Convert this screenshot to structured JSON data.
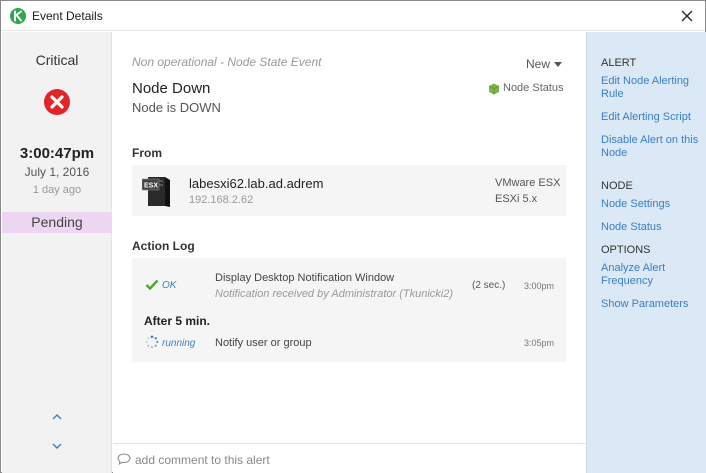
{
  "window": {
    "title": "Event Details",
    "close_icon": "close-icon"
  },
  "left": {
    "severity": "Critical",
    "severity_icon": "critical-x-icon",
    "severity_color": "#e02626",
    "time": "3:00:47pm",
    "date": "July 1, 2016",
    "ago": "1 day ago",
    "state": "Pending",
    "state_color": "#ecd6f2"
  },
  "event": {
    "type": "Non operational - Node State Event",
    "status": "New",
    "title": "Node Down",
    "subtitle": "Node is DOWN",
    "monitor_label": "Node Status",
    "monitor_icon_color": "#7ab648"
  },
  "from": {
    "heading": "From",
    "node_name": "labesxi62.lab.ad.adrem",
    "node_ip": "192.168.2.62",
    "os_line1": "VMware ESX",
    "os_line2": "ESXi 5.x"
  },
  "action_log": {
    "heading": "Action Log",
    "rows": [
      {
        "status": "OK",
        "action": "Display Desktop Notification Window",
        "note": "Notification received by Administrator (Tkunicki2)",
        "duration": "(2 sec.)",
        "time": "3:00pm"
      },
      {
        "status": "running",
        "action": "Notify user or group",
        "time": "3:05pm"
      }
    ],
    "delay_label": "After 5 min."
  },
  "comment": {
    "placeholder": "add comment to this alert"
  },
  "sidebar": {
    "alert_heading": "ALERT",
    "alert_links": [
      "Edit Node Alerting Rule",
      "Edit Alerting Script",
      "Disable Alert on this Node"
    ],
    "node_heading": "NODE",
    "node_links": [
      "Node Settings",
      "Node Status"
    ],
    "options_heading": "OPTIONS",
    "options_links": [
      "Analyze Alert Frequency",
      "Show Parameters"
    ],
    "link_color": "#3a7fc4",
    "panel_color": "#dbe8f5"
  }
}
